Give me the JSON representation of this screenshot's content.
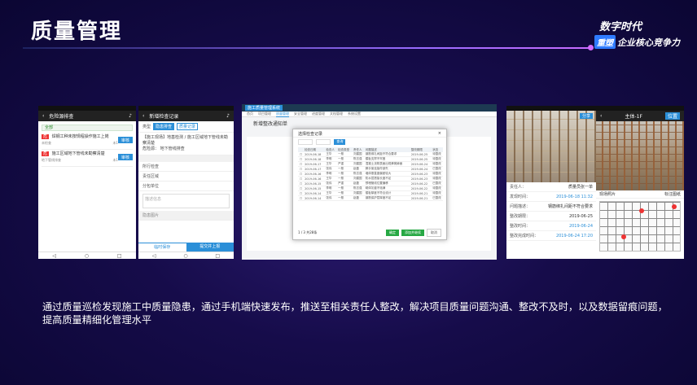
{
  "header": {
    "title": "质量管理",
    "slogan_top": "数字时代",
    "slogan_badge": "重塑",
    "slogan_text": "企业核心竞争力"
  },
  "phone1": {
    "nav_title": "危险源排查",
    "search": "全部",
    "items": [
      {
        "tag": "危",
        "text": "焊钢工种未按规程操作施工上岗",
        "sub": "未检查",
        "count": "未1",
        "btn": "审核"
      },
      {
        "tag": "危",
        "text": "施工区域地下管线未勘察清楚",
        "sub": "地下管线排查",
        "count": "未1",
        "btn": "审核"
      }
    ]
  },
  "phone2": {
    "nav_title": "新增检查记录",
    "type_label": "类型",
    "chip_a": "隐患排查",
    "chip_b": "质量记录",
    "text1": "【施工现场】地基检测 / 施工区域地下管线未勘察清楚",
    "risk_label": "危险源：",
    "risk_value": "地下管线排查",
    "rows": [
      "所行检查",
      "责任区域",
      "分包单位"
    ],
    "placeholder": "描述信息",
    "section": "隐患图片",
    "btn_left": "临时保存",
    "btn_right": "提交并上报"
  },
  "desktop": {
    "logo": "施工质量管理系统",
    "tabs": [
      "首页",
      "项目管理",
      "质量管理",
      "安全管理",
      "进度管理",
      "文档管理",
      "系统设置"
    ],
    "active_tab": "质量管理",
    "page_title": "新增整改通知单",
    "modal_title": "选择检查记录",
    "filter_btn": "查询",
    "table_head": [
      "",
      "检查日期",
      "检查人",
      "检查类型",
      "责任人",
      "问题描述",
      "整改期限",
      "状态"
    ],
    "table_rows": [
      [
        "☐",
        "2019-06-18",
        "王华",
        "一般",
        "刘建国",
        "钢筋绑扎间距不符合要求",
        "2019-06-25",
        "待整改"
      ],
      [
        "☐",
        "2019-06-18",
        "李明",
        "一般",
        "陈志强",
        "模板支撑不牢固",
        "2019-06-25",
        "待整改"
      ],
      [
        "☐",
        "2019-06-17",
        "王华",
        "严重",
        "刘建国",
        "混凝土浇筑表面出现蜂窝麻面",
        "2019-06-24",
        "待整改"
      ],
      [
        "☐",
        "2019-06-17",
        "张伟",
        "一般",
        "赵磊",
        "脚手架连接件缺失",
        "2019-06-24",
        "已整改"
      ],
      [
        "☐",
        "2019-06-16",
        "李明",
        "一般",
        "陈志强",
        "墙体垂直度偏差较大",
        "2019-06-23",
        "待整改"
      ],
      [
        "☐",
        "2019-06-16",
        "王华",
        "一般",
        "刘建国",
        "防水层搭接长度不足",
        "2019-06-23",
        "待整改"
      ],
      [
        "☐",
        "2019-06-15",
        "张伟",
        "严重",
        "赵磊",
        "预埋管线位置偏移",
        "2019-06-22",
        "已整改"
      ],
      [
        "☐",
        "2019-06-15",
        "李明",
        "一般",
        "陈志强",
        "砌体灰缝不饱满",
        "2019-06-22",
        "待整改"
      ],
      [
        "☐",
        "2019-06-14",
        "王华",
        "一般",
        "刘建国",
        "楼板厚度不符合设计",
        "2019-06-21",
        "待整改"
      ],
      [
        "☐",
        "2019-06-14",
        "张伟",
        "一般",
        "赵磊",
        "钢筋保护层厚度不足",
        "2019-06-21",
        "已整改"
      ]
    ],
    "page_info": "1 / 3  共28条",
    "btn_ok": "确定",
    "btn_next": "添加并继续",
    "btn_cancel": "取消"
  },
  "phone3": {
    "share": "分享",
    "label1": "责任人：",
    "value1": "质量员张一单",
    "label2": "发现时间：",
    "value2": "2019-06-18 11:32",
    "label3": "问题描述：",
    "value3": "钢筋绑扎间距不符合要求",
    "label4": "整改期限：",
    "value4": "2019-06-25",
    "label5": "整改时间：",
    "value5": "2019-06-24",
    "label6": "整改完成时间：",
    "value6": "2019-06-24 17:20"
  },
  "phone4": {
    "nav_title": "主体-1F",
    "pill": "位置",
    "tab_left": "现场照片",
    "tab_right": "标注图纸"
  },
  "description": "通过质量巡检发现施工中质量隐患，通过手机端快速发布，推送至相关责任人整改，解决项目质量问题沟通、整改不及时，以及数据留痕问题，提高质量精细化管理水平"
}
